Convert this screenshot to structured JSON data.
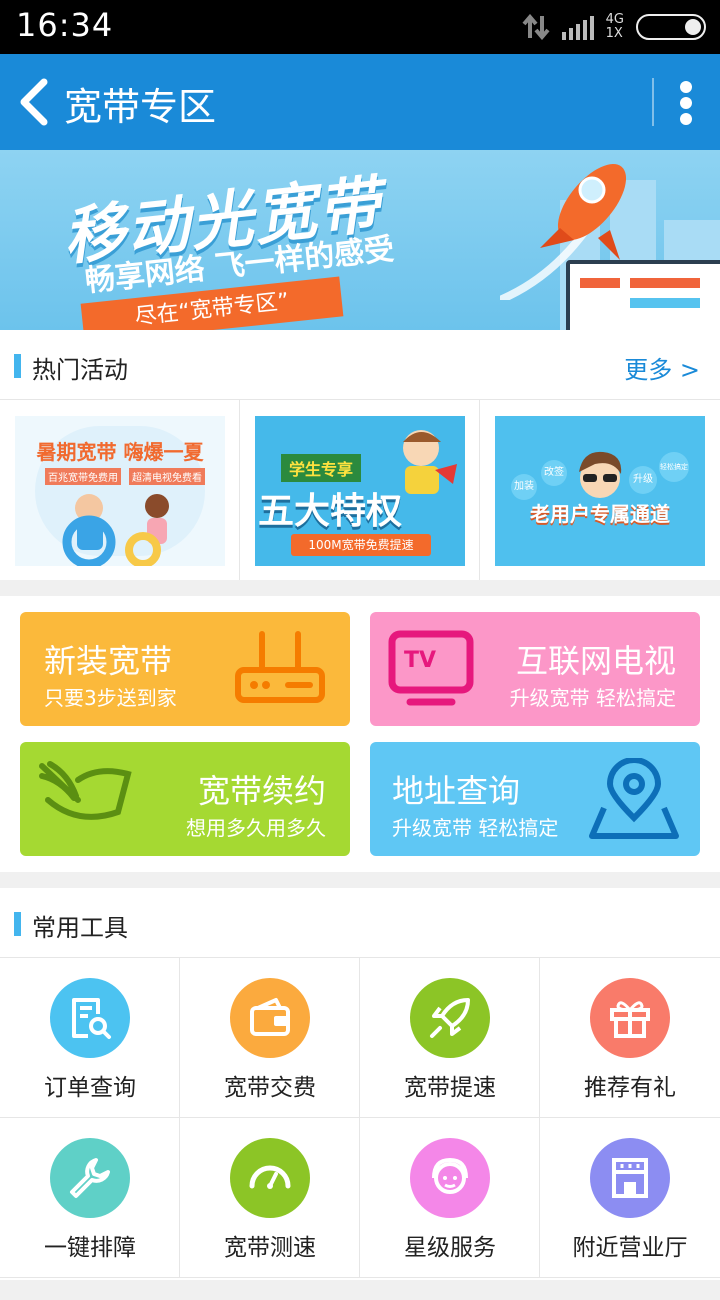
{
  "status_bar": {
    "time": "16:34",
    "network_line1": "4G",
    "network_line2": "1X"
  },
  "header": {
    "title": "宽带专区"
  },
  "banner": {
    "headline": "移动光宽带",
    "tagline": "畅享网络 飞一样的感受",
    "ribbon": "尽在“宽带专区”"
  },
  "hot": {
    "title": "热门活动",
    "more": "更多 >",
    "items": [
      {
        "title": "暑期宽带 嗨爆一夏",
        "sub1": "百兆宽带免费用",
        "sub2": "超清电视免费看"
      },
      {
        "tag": "学生专享",
        "title": "五大特权",
        "sub": "100M宽带免费提速"
      },
      {
        "title": "老用户专属通道",
        "b1": "加装",
        "b2": "改签",
        "b3": "升级",
        "b4": "轻松搞定"
      }
    ]
  },
  "services": [
    {
      "title": "新装宽带",
      "sub": "只要3步送到家",
      "color": "#fbb93b"
    },
    {
      "title": "互联网电视",
      "sub": "升级宽带 轻松搞定",
      "color": "#fc97c8",
      "icon_text": "TV"
    },
    {
      "title": "宽带续约",
      "sub": "想用多久用多久",
      "color": "#a5d932"
    },
    {
      "title": "地址查询",
      "sub": "升级宽带 轻松搞定",
      "color": "#5fc7f4"
    }
  ],
  "tools": {
    "title": "常用工具",
    "items": [
      {
        "label": "订单查询",
        "icon": "document-search-icon",
        "color": "#4cc3f1"
      },
      {
        "label": "宽带交费",
        "icon": "wallet-icon",
        "color": "#fbaa3e"
      },
      {
        "label": "宽带提速",
        "icon": "rocket-icon",
        "color": "#8cc526"
      },
      {
        "label": "推荐有礼",
        "icon": "gift-icon",
        "color": "#f97b6a"
      },
      {
        "label": "一键排障",
        "icon": "wrench-icon",
        "color": "#5fd0c7"
      },
      {
        "label": "宽带测速",
        "icon": "speedometer-icon",
        "color": "#8cc526"
      },
      {
        "label": "星级服务",
        "icon": "headset-agent-icon",
        "color": "#f487e8"
      },
      {
        "label": "附近营业厅",
        "icon": "storefront-icon",
        "color": "#8c8df2"
      }
    ]
  }
}
